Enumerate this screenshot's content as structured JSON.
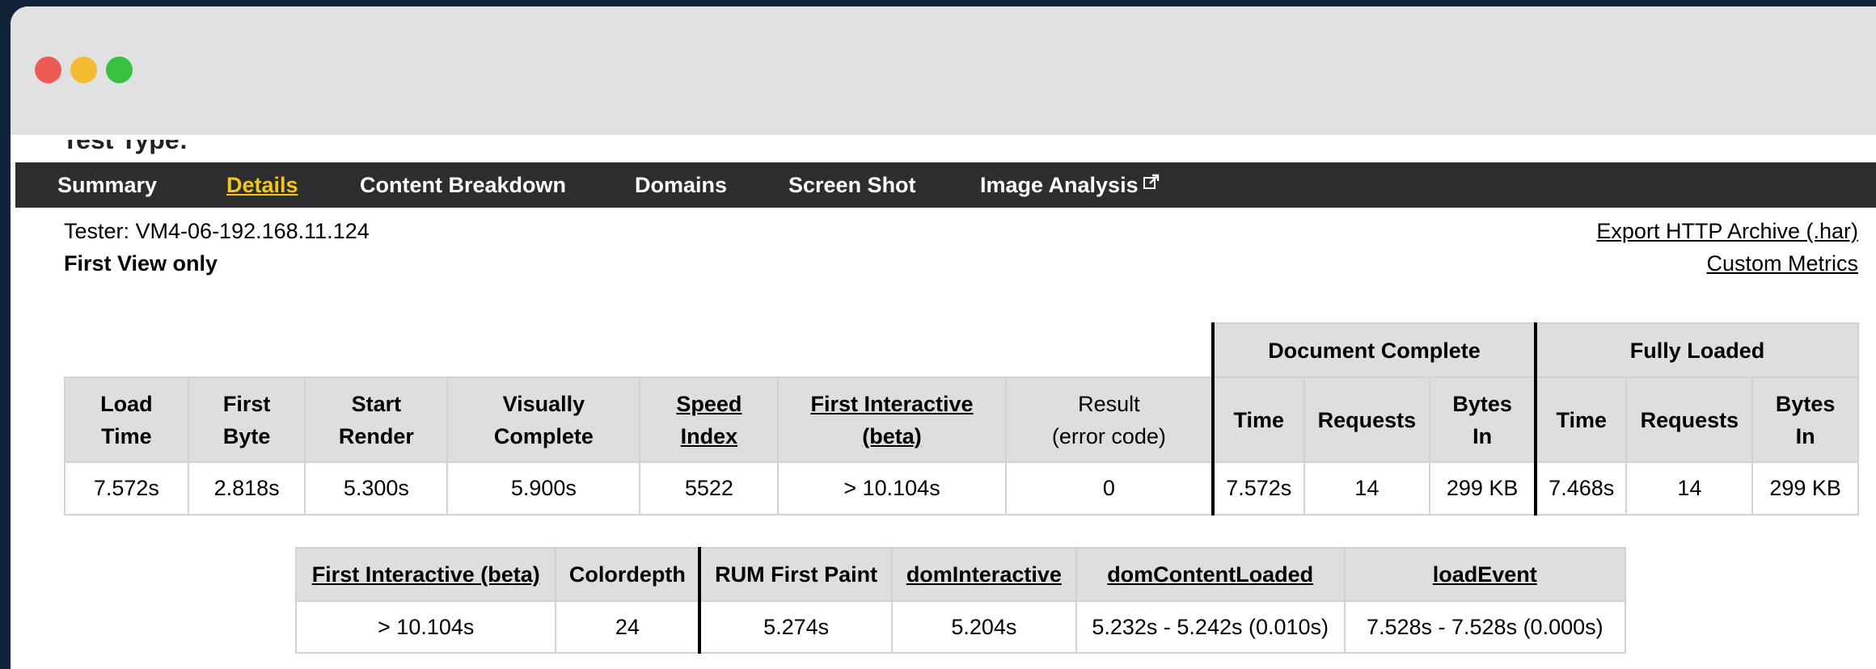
{
  "window": {
    "controls": [
      "close",
      "minimize",
      "maximize"
    ]
  },
  "cutoff_text": "Test Type:",
  "nav": {
    "items": [
      {
        "label": "Summary",
        "active": false
      },
      {
        "label": "Details",
        "active": true
      },
      {
        "label": "Content Breakdown",
        "active": false
      },
      {
        "label": "Domains",
        "active": false
      },
      {
        "label": "Screen Shot",
        "active": false
      },
      {
        "label": "Image Analysis",
        "active": false,
        "icon": "external-link-icon"
      }
    ]
  },
  "info": {
    "tester": "Tester: VM4-06-192.168.11.124",
    "view": "First View only",
    "export_link": "Export HTTP Archive (.har)",
    "custom_metrics_link": "Custom Metrics"
  },
  "main_table": {
    "group_headers": {
      "document_complete": "Document Complete",
      "fully_loaded": "Fully Loaded"
    },
    "headers": {
      "load_time": [
        "Load",
        "Time"
      ],
      "first_byte": [
        "First",
        "Byte"
      ],
      "start_render": [
        "Start",
        "Render"
      ],
      "visually_complete": [
        "Visually",
        "Complete"
      ],
      "speed_index": [
        "Speed",
        "Index"
      ],
      "first_interactive": [
        "First Interactive",
        "(beta)"
      ],
      "result": [
        "Result",
        "(error code)"
      ],
      "dc_time": "Time",
      "dc_requests": "Requests",
      "dc_bytes": [
        "Bytes",
        "In"
      ],
      "fl_time": "Time",
      "fl_requests": "Requests",
      "fl_bytes": [
        "Bytes",
        "In"
      ]
    },
    "row": {
      "load_time": "7.572s",
      "first_byte": "2.818s",
      "start_render": "5.300s",
      "visually_complete": "5.900s",
      "speed_index": "5522",
      "first_interactive": "> 10.104s",
      "result": "0",
      "dc_time": "7.572s",
      "dc_requests": "14",
      "dc_bytes": "299 KB",
      "fl_time": "7.468s",
      "fl_requests": "14",
      "fl_bytes": "299 KB"
    }
  },
  "second_table": {
    "headers": {
      "first_interactive": "First Interactive (beta)",
      "colordepth": "Colordepth",
      "rum_first_paint": "RUM First Paint",
      "dom_interactive": "domInteractive",
      "dom_content_loaded": "domContentLoaded",
      "load_event": "loadEvent"
    },
    "row": {
      "first_interactive": "> 10.104s",
      "colordepth": "24",
      "rum_first_paint": "5.274s",
      "dom_interactive": "5.204s",
      "dom_content_loaded": "5.232s - 5.242s (0.010s)",
      "load_event": "7.528s - 7.528s (0.000s)"
    }
  }
}
